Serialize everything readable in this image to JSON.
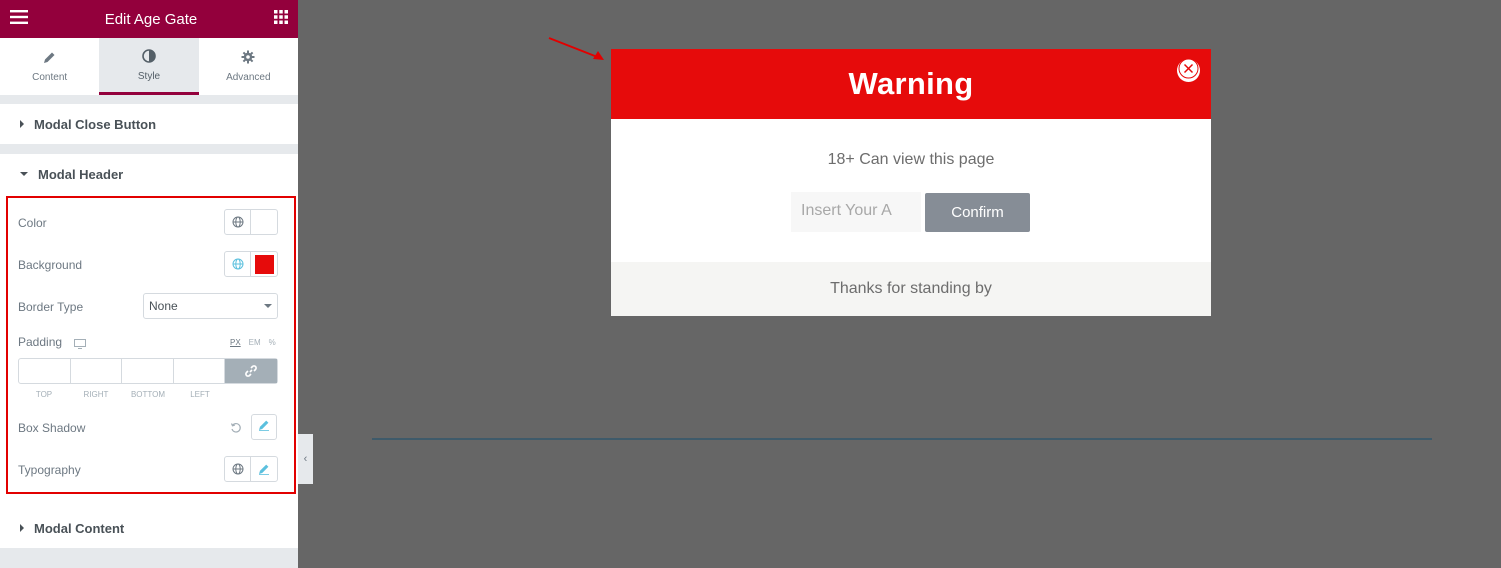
{
  "panel": {
    "title": "Edit Age Gate",
    "menu_icon": "hamburger-icon",
    "grid_icon": "grid-icon",
    "tabs": [
      {
        "label": "Content",
        "icon": "pencil-icon"
      },
      {
        "label": "Style",
        "icon": "contrast-icon",
        "active": true
      },
      {
        "label": "Advanced",
        "icon": "gear-icon"
      }
    ],
    "sections": {
      "close_button": "Modal Close Button",
      "header": "Modal Header",
      "content": "Modal Content"
    },
    "controls": {
      "color_label": "Color",
      "background_label": "Background",
      "background_color": "#e60b0b",
      "border_type_label": "Border Type",
      "border_type_value": "None",
      "padding_label": "Padding",
      "units": [
        "PX",
        "EM",
        "%"
      ],
      "dimensions": [
        "TOP",
        "RIGHT",
        "BOTTOM",
        "LEFT"
      ],
      "box_shadow_label": "Box Shadow",
      "typography_label": "Typography"
    }
  },
  "modal": {
    "title": "Warning",
    "message": "18+ Can view this page",
    "input_value": "Insert Your A",
    "confirm_label": "Confirm",
    "footer": "Thanks for standing by",
    "header_color": "#e60b0b"
  },
  "colors": {
    "brand": "#93003c",
    "highlight": "#e20000"
  }
}
